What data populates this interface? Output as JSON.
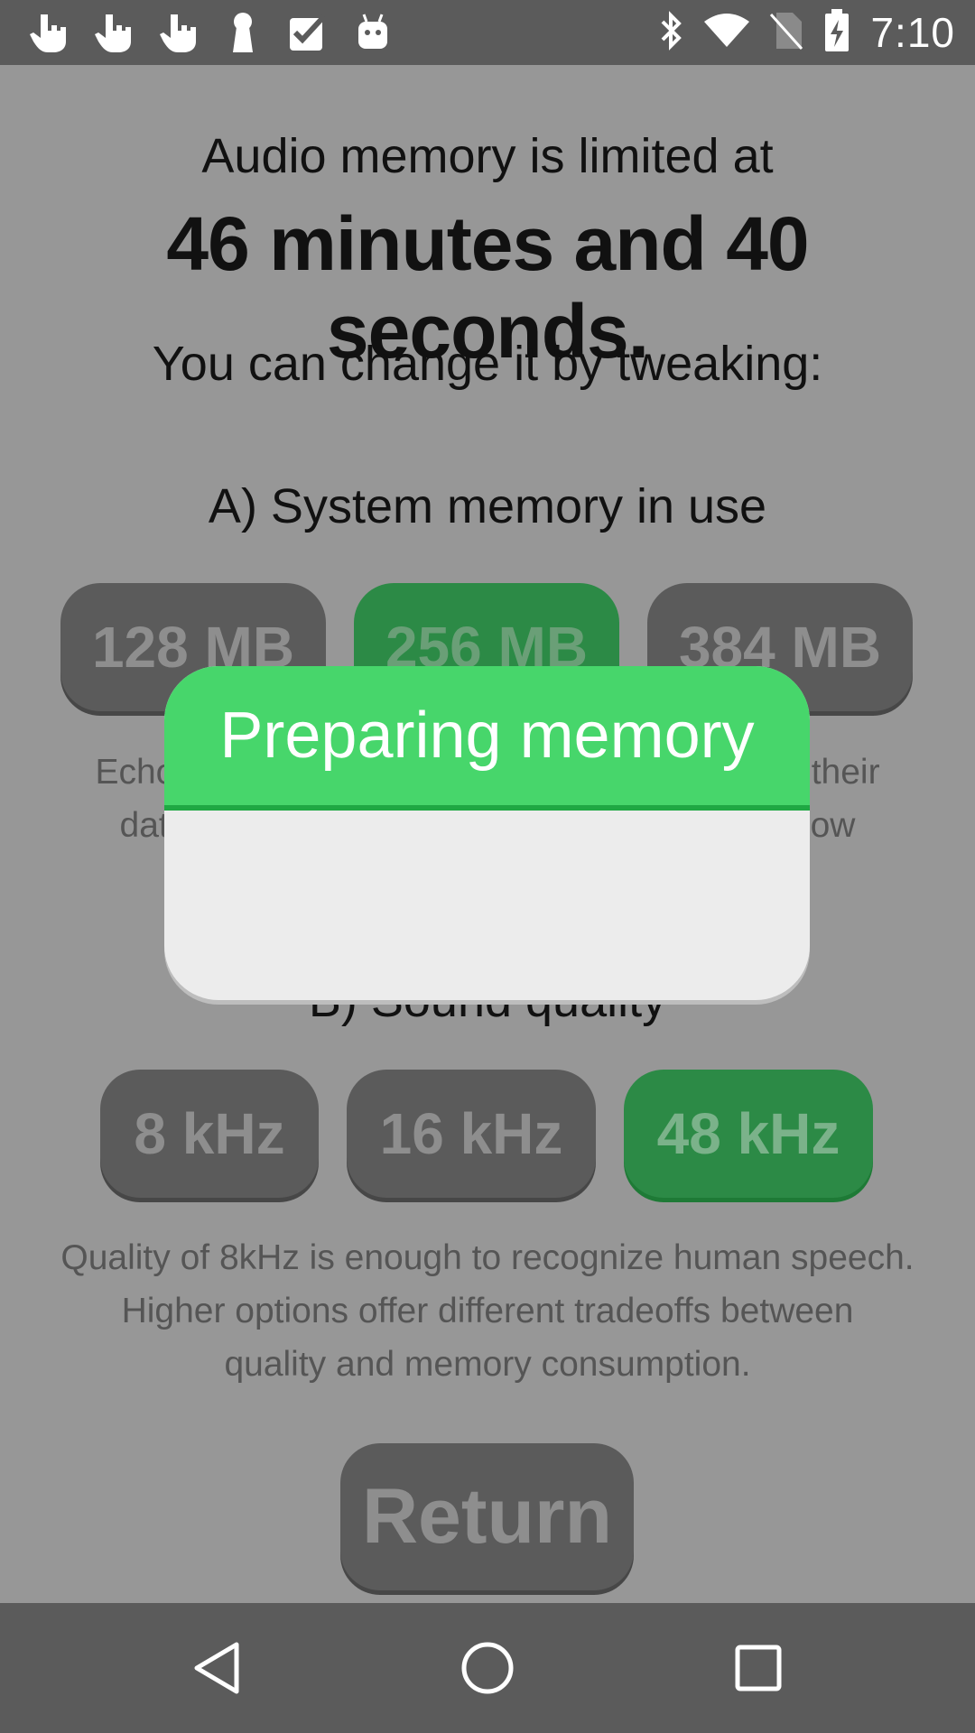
{
  "status_bar": {
    "left_icons": [
      "touch-hand-icon",
      "touch-hand-icon",
      "touch-hand-icon",
      "keyhole-icon",
      "checkbox-icon",
      "android-icon"
    ],
    "right_icons": [
      "bluetooth-icon",
      "wifi-icon",
      "no-sim-icon",
      "battery-charging-icon"
    ],
    "time": "7:10"
  },
  "content": {
    "intro": "Audio memory is limited at",
    "limit": "46 minutes and 40 seconds.",
    "change_hint": "You can change it by tweaking:",
    "section_a": {
      "title": "A) System memory in use",
      "options": [
        "128 MB",
        "256 MB",
        "384 MB"
      ],
      "selected": "256 MB",
      "description_line1": "Echo a                                                         ep their",
      "description_line2": "data.                                                            slow"
    },
    "section_b": {
      "title": "B) Sound quality",
      "options": [
        "8 kHz",
        "16 kHz",
        "48 kHz"
      ],
      "selected": "48 kHz",
      "description_lines": [
        "Quality of 8kHz is enough to recognize human speech.",
        "Higher options offer different tradeoffs between",
        "quality and memory consumption."
      ]
    },
    "return_label": "Return"
  },
  "dialog": {
    "title": "Preparing memory"
  },
  "nav_bar": {
    "buttons": [
      "back-icon",
      "home-icon",
      "recents-icon"
    ]
  },
  "colors": {
    "background": "#979797",
    "bars": "#5b5b5b",
    "button": "#5b5b5b",
    "selected": "#2c8a46",
    "dialog_header": "#47d66b",
    "dialog_body": "#ececec"
  }
}
